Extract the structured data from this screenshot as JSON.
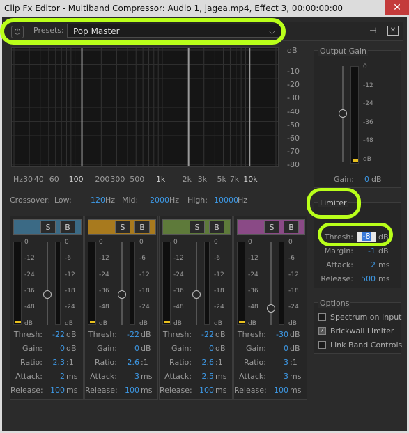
{
  "window": {
    "title": "Clip Fx Editor - Multiband Compressor: Audio 1, jagea.mp4, Effect 3, 00:00:00:00",
    "close_icon": "close-icon"
  },
  "toolbar": {
    "presets_label": "Presets:",
    "preset_value": "Pop Master",
    "power_icon": "power-icon",
    "route_icon": "routing-icon",
    "clear_icon": "clear-icon"
  },
  "spectrum": {
    "db_unit": "dB",
    "db_ticks": [
      "-10",
      "-20",
      "-30",
      "-40",
      "-50",
      "-60",
      "-70",
      "-80"
    ],
    "hz_ticks": [
      "Hz",
      "30",
      "40",
      "60",
      "100",
      "200",
      "300",
      "500",
      "1k",
      "2k",
      "3k",
      "5k",
      "7k",
      "10k"
    ]
  },
  "crossover": {
    "label": "Crossover:",
    "low_label": "Low:",
    "low_value": "120",
    "mid_label": "Mid:",
    "mid_value": "2000",
    "high_label": "High:",
    "high_value": "10000",
    "unit": "Hz"
  },
  "band_labels": {
    "thresh": "Thresh:",
    "gain": "Gain:",
    "ratio": "Ratio:",
    "attack": "Attack:",
    "release": "Release:",
    "solo": "S",
    "bypass": "B"
  },
  "meter_scale": [
    "0",
    "-12",
    "-24",
    "-36",
    "-48",
    "dB"
  ],
  "gr_scale": [
    "0",
    "-6",
    "-12",
    "-18",
    "-24",
    "dB"
  ],
  "bands": [
    {
      "color": "#3b6a85",
      "thresh": "-22",
      "thresh_unit": "dB",
      "gain": "0",
      "gain_unit": "dB",
      "ratio": "2.3",
      "ratio_unit": ":1",
      "attack": "2",
      "attack_unit": "ms",
      "release": "100",
      "release_unit": "ms",
      "fader_level": 0.72
    },
    {
      "color": "#a87a1e",
      "thresh": "-22",
      "thresh_unit": "dB",
      "gain": "0",
      "gain_unit": "dB",
      "ratio": "2.6",
      "ratio_unit": ":1",
      "attack": "3",
      "attack_unit": "ms",
      "release": "100",
      "release_unit": "ms",
      "fader_level": 0.72
    },
    {
      "color": "#5e7a3a",
      "thresh": "-22",
      "thresh_unit": "dB",
      "gain": "0",
      "gain_unit": "dB",
      "ratio": "2.6",
      "ratio_unit": ":1",
      "attack": "2.5",
      "attack_unit": "ms",
      "release": "100",
      "release_unit": "ms",
      "fader_level": 0.72
    },
    {
      "color": "#8a4a86",
      "thresh": "-30",
      "thresh_unit": "dB",
      "gain": "0",
      "gain_unit": "dB",
      "ratio": "3",
      "ratio_unit": ":1",
      "attack": "3",
      "attack_unit": "ms",
      "release": "100",
      "release_unit": "ms",
      "fader_level": 0.55
    }
  ],
  "output_gain": {
    "title": "Output Gain",
    "scale": [
      "0",
      "-12",
      "-24",
      "-36",
      "-48",
      "dB"
    ],
    "gain_label": "Gain:",
    "gain_value": "0",
    "gain_unit": "dB"
  },
  "limiter": {
    "title": "Limiter",
    "thresh_label": "Thresh:",
    "thresh_value": "-8",
    "thresh_unit": "dB",
    "margin_label": "Margin:",
    "margin_value": "-1",
    "margin_unit": "dB",
    "attack_label": "Attack:",
    "attack_value": "2",
    "attack_unit": "ms",
    "release_label": "Release:",
    "release_value": "500",
    "release_unit": "ms"
  },
  "options": {
    "title": "Options",
    "items": [
      {
        "label": "Spectrum on Input",
        "checked": false
      },
      {
        "label": "Brickwall Limiter",
        "checked": true
      },
      {
        "label": "Link Band Controls",
        "checked": false
      }
    ]
  },
  "colors": {
    "accent_blue": "#3d9ae8",
    "annotation_highlight": "#b9ff1a",
    "meter_level": "#e8c01e"
  }
}
